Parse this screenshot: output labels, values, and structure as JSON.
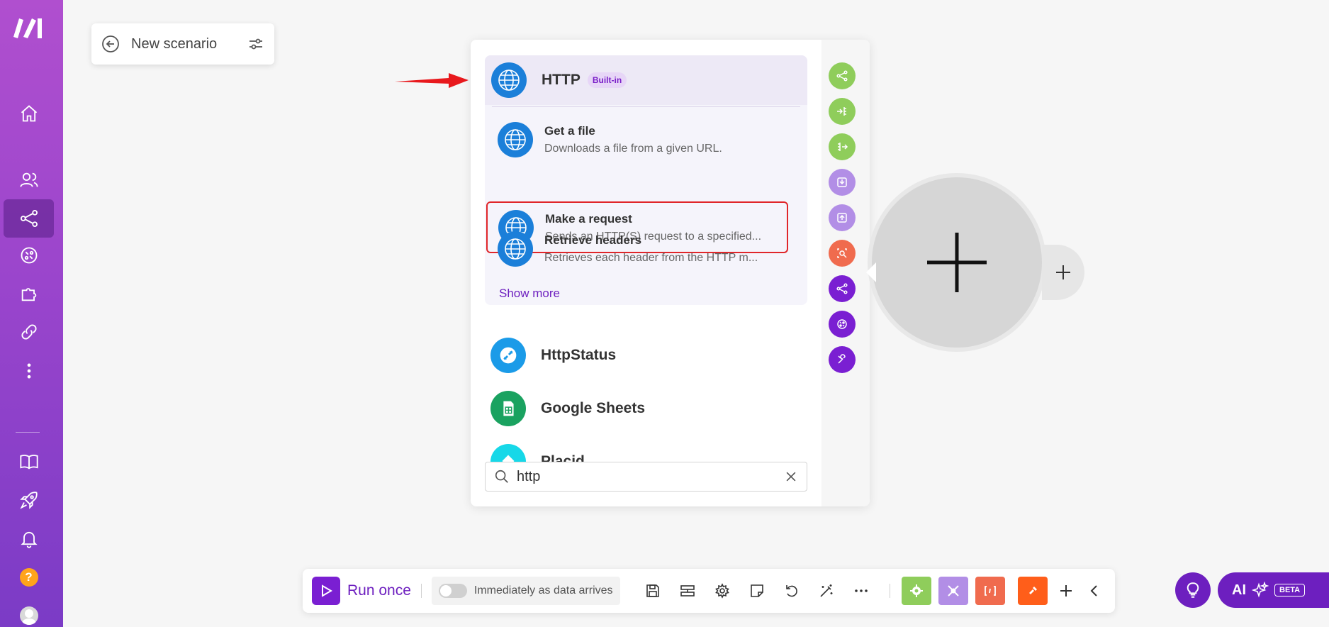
{
  "scenario": {
    "name": "New scenario"
  },
  "sidebar": {
    "items": [
      {
        "name": "home-icon"
      },
      {
        "name": "team-icon"
      },
      {
        "name": "scenarios-icon",
        "active": true
      },
      {
        "name": "templates-icon"
      },
      {
        "name": "apps-icon"
      },
      {
        "name": "connections-icon"
      },
      {
        "name": "more-icon"
      },
      {
        "name": "docs-icon"
      },
      {
        "name": "launch-icon"
      },
      {
        "name": "notifications-icon"
      }
    ],
    "help_label": "?"
  },
  "picker": {
    "http_group": {
      "title": "HTTP",
      "badge": "Built-in",
      "actions": [
        {
          "title": "Get a file",
          "desc": "Downloads a file from a given URL."
        },
        {
          "title": "Make a request",
          "desc": "Sends an HTTP(S) request to a specified..."
        },
        {
          "title": "Retrieve headers",
          "desc": "Retrieves each header from the HTTP m..."
        }
      ],
      "show_more": "Show more"
    },
    "apps": [
      {
        "name": "HttpStatus",
        "color": "#1b9be8"
      },
      {
        "name": "Google Sheets",
        "color": "#1aa260"
      },
      {
        "name": "Placid",
        "color": "#17d8e8"
      }
    ],
    "search": {
      "value": "http"
    },
    "tools": [
      {
        "name": "router-tool",
        "color": "#8fcd5b"
      },
      {
        "name": "iterator-tool",
        "color": "#8fcd5b"
      },
      {
        "name": "aggregator-tool",
        "color": "#8fcd5b"
      },
      {
        "name": "import-tool",
        "color": "#b28ee6"
      },
      {
        "name": "export-tool",
        "color": "#b28ee6"
      },
      {
        "name": "search-tool",
        "color": "#f06b4e"
      },
      {
        "name": "flow-tool",
        "color": "#7a1fd2"
      },
      {
        "name": "scenario-tool",
        "color": "#7a1fd2"
      },
      {
        "name": "tools-tool",
        "color": "#7a1fd2"
      }
    ]
  },
  "toolbar": {
    "run_label": "Run once",
    "schedule_label": "Immediately as data arrives",
    "colors": {
      "tools": "#8fcd5b",
      "flow": "#b28ee6",
      "text_parser": "#f06b4e",
      "make_dev": "#ff5e1a"
    }
  },
  "ai": {
    "label": "AI",
    "beta": "BETA"
  },
  "colors": {
    "brand": "#6d1fbf",
    "highlight": "#e0262a",
    "http_globe": "#1b7fd9"
  }
}
